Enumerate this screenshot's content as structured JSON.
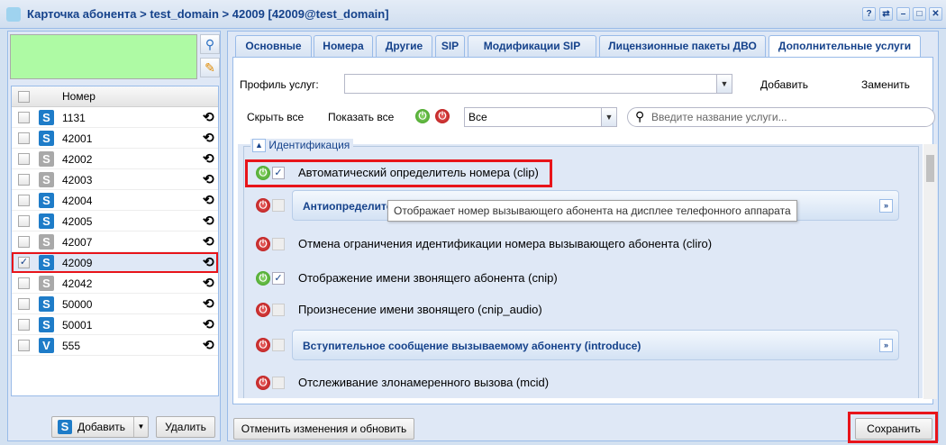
{
  "window": {
    "title": "Карточка абонента > test_domain > 42009 [42009@test_domain]",
    "controls": [
      "?",
      "⇄",
      "–",
      "□",
      "✕"
    ]
  },
  "left": {
    "header": "Номер",
    "rows": [
      {
        "number": "1131",
        "type": "S",
        "color": "blue",
        "checked": false
      },
      {
        "number": "42001",
        "type": "S",
        "color": "blue",
        "checked": false
      },
      {
        "number": "42002",
        "type": "S",
        "color": "grey",
        "checked": false
      },
      {
        "number": "42003",
        "type": "S",
        "color": "grey",
        "checked": false
      },
      {
        "number": "42004",
        "type": "S",
        "color": "blue",
        "checked": false
      },
      {
        "number": "42005",
        "type": "S",
        "color": "blue",
        "checked": false
      },
      {
        "number": "42007",
        "type": "S",
        "color": "grey",
        "checked": false
      },
      {
        "number": "42009",
        "type": "S",
        "color": "blue",
        "checked": true,
        "selected": true
      },
      {
        "number": "42042",
        "type": "S",
        "color": "grey",
        "checked": false
      },
      {
        "number": "50000",
        "type": "S",
        "color": "blue",
        "checked": false
      },
      {
        "number": "50001",
        "type": "S",
        "color": "blue",
        "checked": false
      },
      {
        "number": "555",
        "type": "V",
        "color": "blue",
        "checked": false
      }
    ],
    "add": "Добавить",
    "delete": "Удалить"
  },
  "tabs": [
    "Основные",
    "Номера",
    "Другие",
    "SIP",
    "Модификации SIP",
    "Лицензионные пакеты ДВО",
    "Дополнительные услуги"
  ],
  "toolbar": {
    "profile_label": "Профиль услуг:",
    "profile_value": "",
    "add": "Добавить",
    "replace": "Заменить",
    "hide_all": "Скрыть все",
    "show_all": "Показать все",
    "filter_value": "Все",
    "search_placeholder": "Введите название услуги..."
  },
  "group": {
    "title": "Идентификация",
    "items": [
      {
        "label": "Автоматический определитель номера (clip)",
        "on": true,
        "checked": true,
        "highlighted": true
      },
      {
        "label": "Антиопределитель",
        "on": false,
        "checked": false,
        "expandable": true
      },
      {
        "label": "Отмена ограничения идентификации номера вызывающего абонента (cliro)",
        "on": false,
        "checked": false
      },
      {
        "label": "Отображение имени звонящего абонента (cnip)",
        "on": true,
        "checked": true
      },
      {
        "label": "Произнесение имени звонящего (cnip_audio)",
        "on": false,
        "checked": false
      },
      {
        "label": "Вступительное сообщение вызываемому абоненту (introduce)",
        "on": false,
        "checked": false,
        "expandable": true
      },
      {
        "label": "Отслеживание злонамеренного вызова (mcid)",
        "on": false,
        "checked": false
      }
    ]
  },
  "tooltip": "Отображает номер вызывающего абонента на дисплее телефонного аппарата",
  "footer": {
    "cancel": "Отменить изменения и обновить",
    "save": "Сохранить"
  },
  "colors": {
    "highlight": "#e8141a",
    "accent": "#15428b"
  }
}
